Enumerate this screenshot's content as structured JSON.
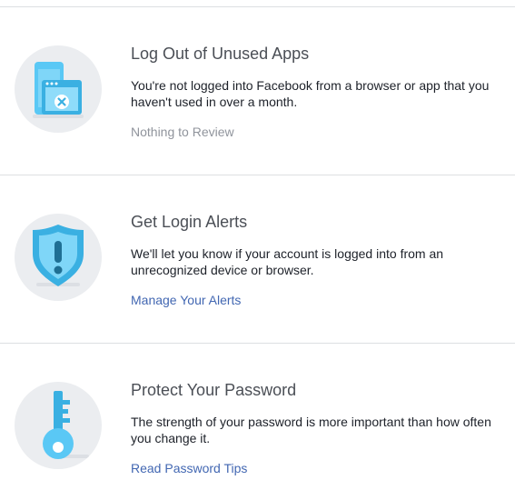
{
  "colors": {
    "accent_blue": "#4267b2",
    "icon_blue": "#5ac8f5",
    "icon_dark_blue": "#3ab0e2",
    "circle_bg": "#ebedf0",
    "muted_text": "#90949c"
  },
  "sections": [
    {
      "icon": "devices-close-icon",
      "title": "Log Out of Unused Apps",
      "description": "You're not logged into Facebook from a browser or app that you haven't used in over a month.",
      "action": "Nothing to Review",
      "action_state": "disabled"
    },
    {
      "icon": "shield-alert-icon",
      "title": "Get Login Alerts",
      "description": "We'll let you know if your account is logged into from an unrecognized device or browser.",
      "action": "Manage Your Alerts",
      "action_state": "link"
    },
    {
      "icon": "key-icon",
      "title": "Protect Your Password",
      "description": "The strength of your password is more important than how often you change it.",
      "action": "Read Password Tips",
      "action_state": "link"
    }
  ]
}
